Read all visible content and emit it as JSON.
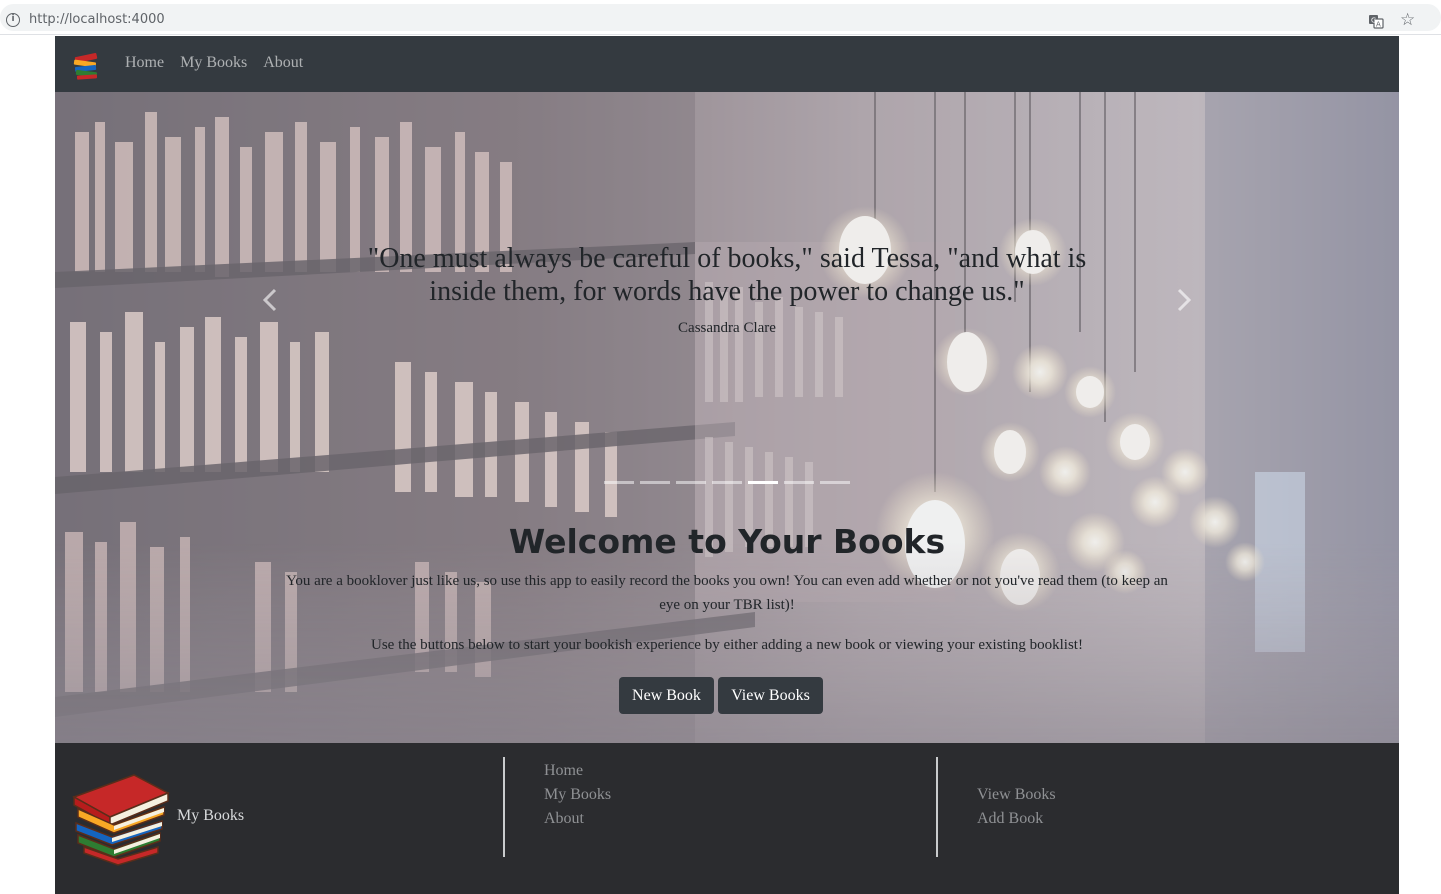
{
  "browser": {
    "url": "http://localhost:4000"
  },
  "navbar": {
    "links": [
      {
        "label": "Home"
      },
      {
        "label": "My Books"
      },
      {
        "label": "About"
      }
    ],
    "background_color": "#343a40"
  },
  "carousel": {
    "quote": "\"One must always be careful of books,\" said Tessa, \"and what is inside them, for words have the power to change us.\"",
    "author": "Cassandra Clare",
    "indicator_count": 7,
    "active_index": 4
  },
  "welcome": {
    "title": "Welcome to Your Books",
    "paragraph_1": "You are a booklover just like us, so use this app to easily record the books you own! You can even add whether or not you've read them (to keep an eye on your TBR list)!",
    "paragraph_2": "Use the buttons below to start your bookish experience by either adding a new book or viewing your existing booklist!",
    "buttons": {
      "new_book": "New Book",
      "view_books": "View Books"
    }
  },
  "footer": {
    "brand": "My Books",
    "column_1": [
      {
        "label": "Home"
      },
      {
        "label": "My Books"
      },
      {
        "label": "About"
      }
    ],
    "column_2": [
      {
        "label": "View Books"
      },
      {
        "label": "Add Book"
      }
    ],
    "background_color": "#2b2c2f"
  }
}
